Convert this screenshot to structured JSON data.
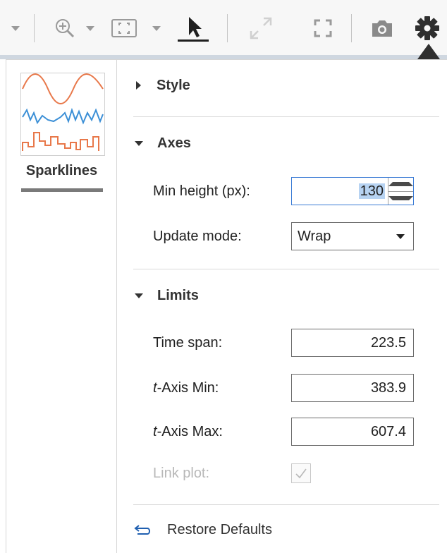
{
  "toolbar": {
    "icons": [
      "dropdown-caret",
      "zoom-in-icon",
      "zoom-caret",
      "fit-view-icon",
      "fit-caret",
      "cursor-icon",
      "expand-icon",
      "fullscreen-icon",
      "camera-icon",
      "gear-icon"
    ],
    "active_tool": "cursor"
  },
  "sidebar": {
    "plot_type_label": "Sparklines"
  },
  "sections": {
    "style": {
      "title": "Style",
      "expanded": false
    },
    "axes": {
      "title": "Axes",
      "expanded": true,
      "min_height_label": "Min height (px):",
      "min_height_value": "130",
      "update_mode_label": "Update mode:",
      "update_mode_value": "Wrap"
    },
    "limits": {
      "title": "Limits",
      "expanded": true,
      "time_span_label": "Time span:",
      "time_span_value": "223.5",
      "t_axis_min_label_italic": "t",
      "t_axis_min_label_rest": "-Axis Min:",
      "t_axis_min_value": "383.9",
      "t_axis_max_label_italic": "t",
      "t_axis_max_label_rest": "-Axis Max:",
      "t_axis_max_value": "607.4",
      "link_plot_label": "Link plot:",
      "link_plot_checked": true,
      "link_plot_enabled": false
    }
  },
  "footer": {
    "restore_label": "Restore Defaults"
  },
  "colors": {
    "accent_blue": "#3a7bd5",
    "sparkline_orange": "#e8784a",
    "sparkline_blue": "#3b8fd6",
    "selection": "#b7d3f2"
  }
}
